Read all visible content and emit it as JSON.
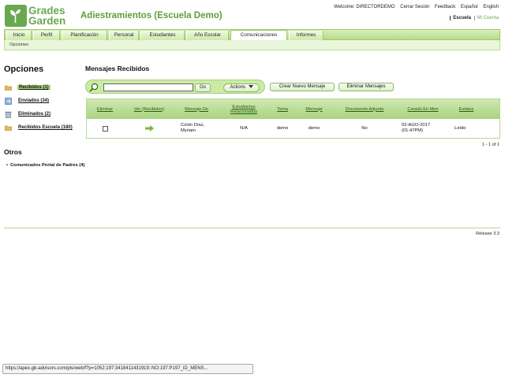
{
  "brand": {
    "line1": "Grades",
    "line2": "Garden",
    "logo_color": "#6aa84f"
  },
  "app_title": "Adiestramientos (Escuela Demo)",
  "top_links": [
    "Welcome: DIRECTORDEMO",
    "Cerrar Sesión",
    "Feedback",
    "Español",
    "English"
  ],
  "sub_links": {
    "current": "Escuela",
    "other": "Mi Cuenta"
  },
  "nav": {
    "tabs": [
      "Inicio",
      "Perfil",
      "Planificación",
      "Personal",
      "Estudiantes",
      "Año Escolar",
      "Comunicaciones",
      "Informes"
    ],
    "active": "Comunicaciones",
    "subnav": "Opciones"
  },
  "left": {
    "title": "Opciones",
    "folders": [
      {
        "label": "Recibidos (1)",
        "icon": "folder-open-icon",
        "selected": true
      },
      {
        "label": "Enviados (34)",
        "icon": "sent-icon",
        "selected": false
      },
      {
        "label": "Eliminados (2)",
        "icon": "trash-icon",
        "selected": false
      },
      {
        "label": "Recibidos Escuela (180)",
        "icon": "folder-icon",
        "selected": false
      }
    ],
    "otros_title": "Otros",
    "otros_items": [
      {
        "bullet": "•",
        "label": "Comunicados Portal de Padres (4)"
      }
    ]
  },
  "main": {
    "title": "Mensajes Recibidos",
    "search": {
      "value": "",
      "placeholder": ""
    },
    "go_label": "Go",
    "actions_label": "Actions",
    "crear_label": "Crear Nuevo Mensaje",
    "eliminar_label": "Eliminar Mensajes",
    "columns": [
      "Eliminar",
      "Ver (Recibidos)",
      "Mensaje De",
      "Estudiantes Relacionados",
      "Tema",
      "Mensaje",
      "Documento Adjunto",
      "Creado En Men",
      "Estatus"
    ],
    "rows": [
      {
        "mensaje_de": "Colón Díaz, Myriam",
        "estudiantes": "N/A",
        "tema": "demo",
        "mensaje": "demo",
        "adjunto": "No",
        "creado": "02-AGO-2017 (01:47PM)",
        "estatus": "Leído"
      }
    ],
    "pagination": "1 - 1 of 1"
  },
  "release": "Release 3.3",
  "status_url": "https://apex.gb-advisors.com/pls/web/f?p=1052:197:3418411431919::NO:197:P197_ID_MENS...",
  "colors": {
    "accent_green": "#6aa84f",
    "header_green": "#a8d380",
    "nav_green": "#b5dc8a"
  }
}
